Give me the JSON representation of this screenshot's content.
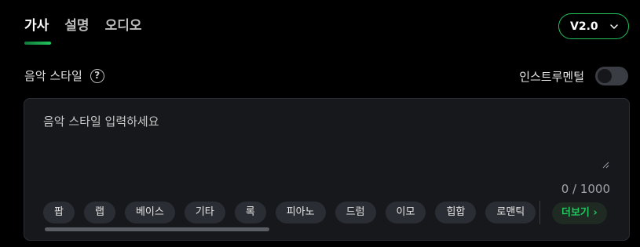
{
  "tabs": [
    {
      "label": "가사",
      "active": true
    },
    {
      "label": "설명",
      "active": false
    },
    {
      "label": "오디오",
      "active": false
    }
  ],
  "version": {
    "label": "V2.0",
    "icon": "chevron-down-icon"
  },
  "style": {
    "label": "음악 스타일",
    "help_icon": "question-circle-icon",
    "help_glyph": "?"
  },
  "instrumental": {
    "label": "인스트루멘털",
    "enabled": false
  },
  "input": {
    "placeholder": "음악 스타일 입력하세요",
    "value": "",
    "counter": "0 / 1000"
  },
  "chips": [
    "팝",
    "랩",
    "베이스",
    "기타",
    "록",
    "피아노",
    "드럼",
    "이모",
    "힙합",
    "로맨틱"
  ],
  "more_button": "더보기 ›",
  "colors": {
    "accent": "#22c55e",
    "background": "#000000",
    "panel": "#16181c",
    "chip": "#2a2d33"
  }
}
